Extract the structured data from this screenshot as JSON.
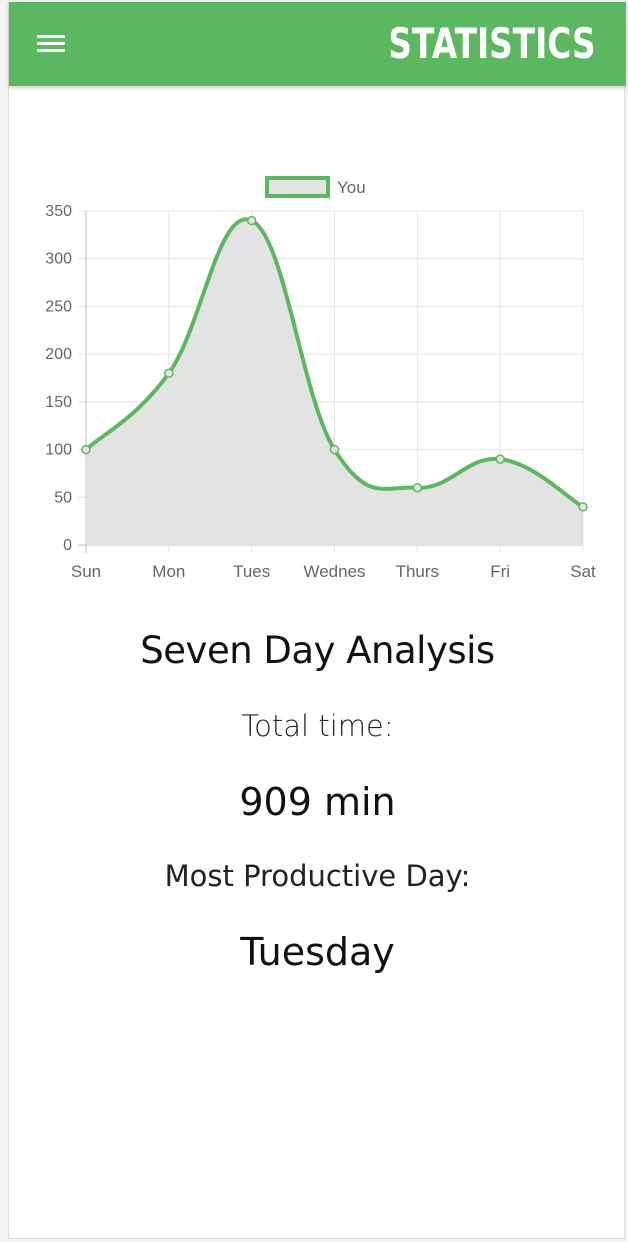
{
  "header": {
    "title": "STATISTICS",
    "menu_icon": "hamburger-menu-icon",
    "color": "#5cb860"
  },
  "chart_data": {
    "type": "line",
    "categories": [
      "Sun",
      "Mon",
      "Tues",
      "Wednes",
      "Thurs",
      "Fri",
      "Sat"
    ],
    "series": [
      {
        "name": "You",
        "values": [
          100,
          180,
          340,
          100,
          60,
          90,
          40
        ],
        "line_color": "#5cb860",
        "fill_color": "#e3e3e3"
      }
    ],
    "y_ticks": [
      0,
      50,
      100,
      150,
      200,
      250,
      300,
      350
    ],
    "ylim": [
      0,
      350
    ],
    "grid": true,
    "legend": "top-center",
    "smooth": true,
    "filled": true
  },
  "summary": {
    "heading": "Seven Day Analysis",
    "total_label": "Total time:",
    "total_value": "909 min",
    "productive_label": "Most Productive Day:",
    "productive_value": "Tuesday"
  }
}
